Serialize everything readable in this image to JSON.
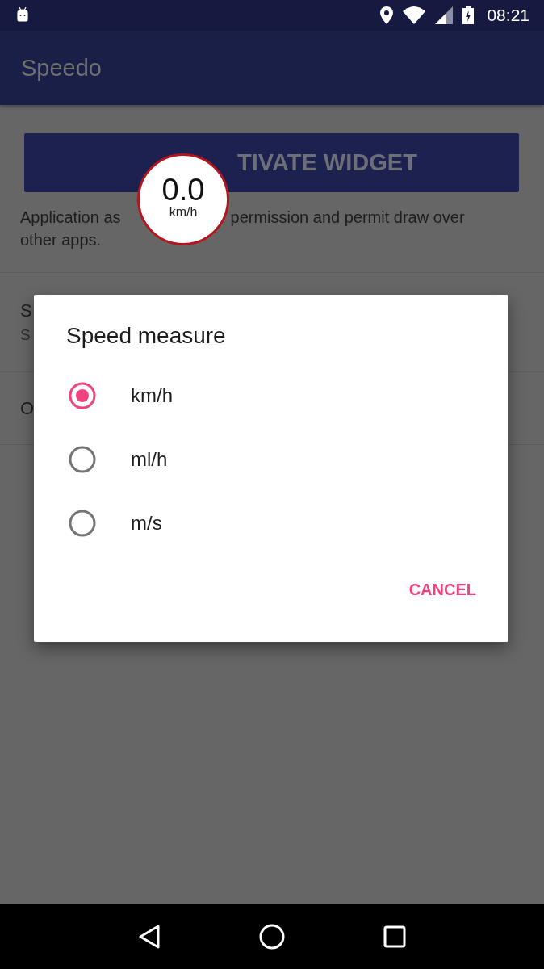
{
  "status_bar": {
    "time": "08:21"
  },
  "app_bar": {
    "title": "Speedo"
  },
  "activate_button": {
    "label": "TIVATE WIDGET"
  },
  "description": {
    "parts": [
      "Application as",
      "permission and permit draw over",
      "other apps."
    ]
  },
  "settings": [
    {
      "title": "S",
      "subtitle": "S"
    },
    {
      "title": "O"
    }
  ],
  "speed_bubble": {
    "value": "0.0",
    "unit": "km/h"
  },
  "dialog": {
    "title": "Speed measure",
    "options": [
      {
        "label": "km/h",
        "selected": true
      },
      {
        "label": "ml/h",
        "selected": false
      },
      {
        "label": "m/s",
        "selected": false
      }
    ],
    "buttons": [
      "CANCEL"
    ]
  }
}
